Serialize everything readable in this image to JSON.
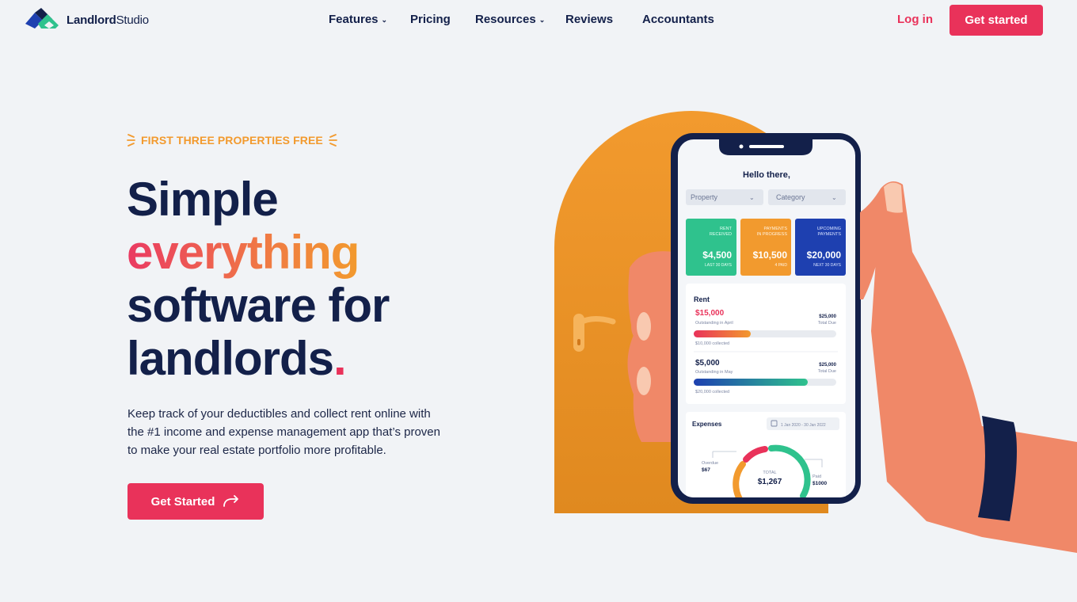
{
  "brand": {
    "name_bold": "Landlord",
    "name_light": "Studio",
    "colors": {
      "primary": "#13204a",
      "accent": "#e9325a",
      "orange": "#f29a2e",
      "green": "#2fc28d",
      "blue": "#1e40b0"
    }
  },
  "nav": {
    "items": [
      {
        "label": "Features",
        "has_dropdown": true
      },
      {
        "label": "Pricing",
        "has_dropdown": false
      },
      {
        "label": "Resources",
        "has_dropdown": true
      },
      {
        "label": "Reviews",
        "has_dropdown": false
      },
      {
        "label": "Accountants",
        "has_dropdown": false
      }
    ],
    "login_label": "Log in",
    "cta_label": "Get started"
  },
  "hero": {
    "eyebrow": "FIRST THREE PROPERTIES FREE",
    "headline": {
      "line1": "Simple",
      "line2": "everything",
      "line3": "software for",
      "line4": "landlords",
      "dot": "."
    },
    "subtext": "Keep track of your deductibles and collect rent online with the #1 income and expense management app that’s proven to make your real estate portfolio more profitable.",
    "cta_label": "Get Started"
  },
  "phone": {
    "greeting": "Hello there,",
    "filters": [
      "Property",
      "Category"
    ],
    "cards": [
      {
        "label_line1": "RENT",
        "label_line2": "RECEIVED",
        "value": "$4,500",
        "caption": "LAST 30 DAYS",
        "color": "#2fc28d"
      },
      {
        "label_line1": "PAYMENTS",
        "label_line2": "IN PROGRESS",
        "value": "$10,500",
        "caption": "4 PAID",
        "color": "#f29a2e"
      },
      {
        "label_line1": "UPCOMING",
        "label_line2": "PAYMENTS",
        "value": "$20,000",
        "caption": "NEXT 30 DAYS",
        "color": "#1e40b0"
      }
    ],
    "rent": {
      "title": "Rent",
      "rows": [
        {
          "amount": "$15,000",
          "note": "Outstanding in April",
          "total": "$25,000",
          "total_label": "Total Due",
          "collected": "$10,000 collected",
          "progress": 0.4
        },
        {
          "amount": "$5,000",
          "note": "Outstanding in May",
          "total": "$25,000",
          "total_label": "Total Due",
          "collected": "$20,000 collected",
          "progress": 0.8
        }
      ]
    },
    "expenses": {
      "title": "Expenses",
      "date_range": "1 Jan 2020 - 30 Jan 2022",
      "overdue_label": "Overdue",
      "overdue_value": "$67",
      "total_label": "TOTAL",
      "total_value": "$1,267",
      "paid_label": "Paid",
      "paid_value": "$1000"
    }
  }
}
